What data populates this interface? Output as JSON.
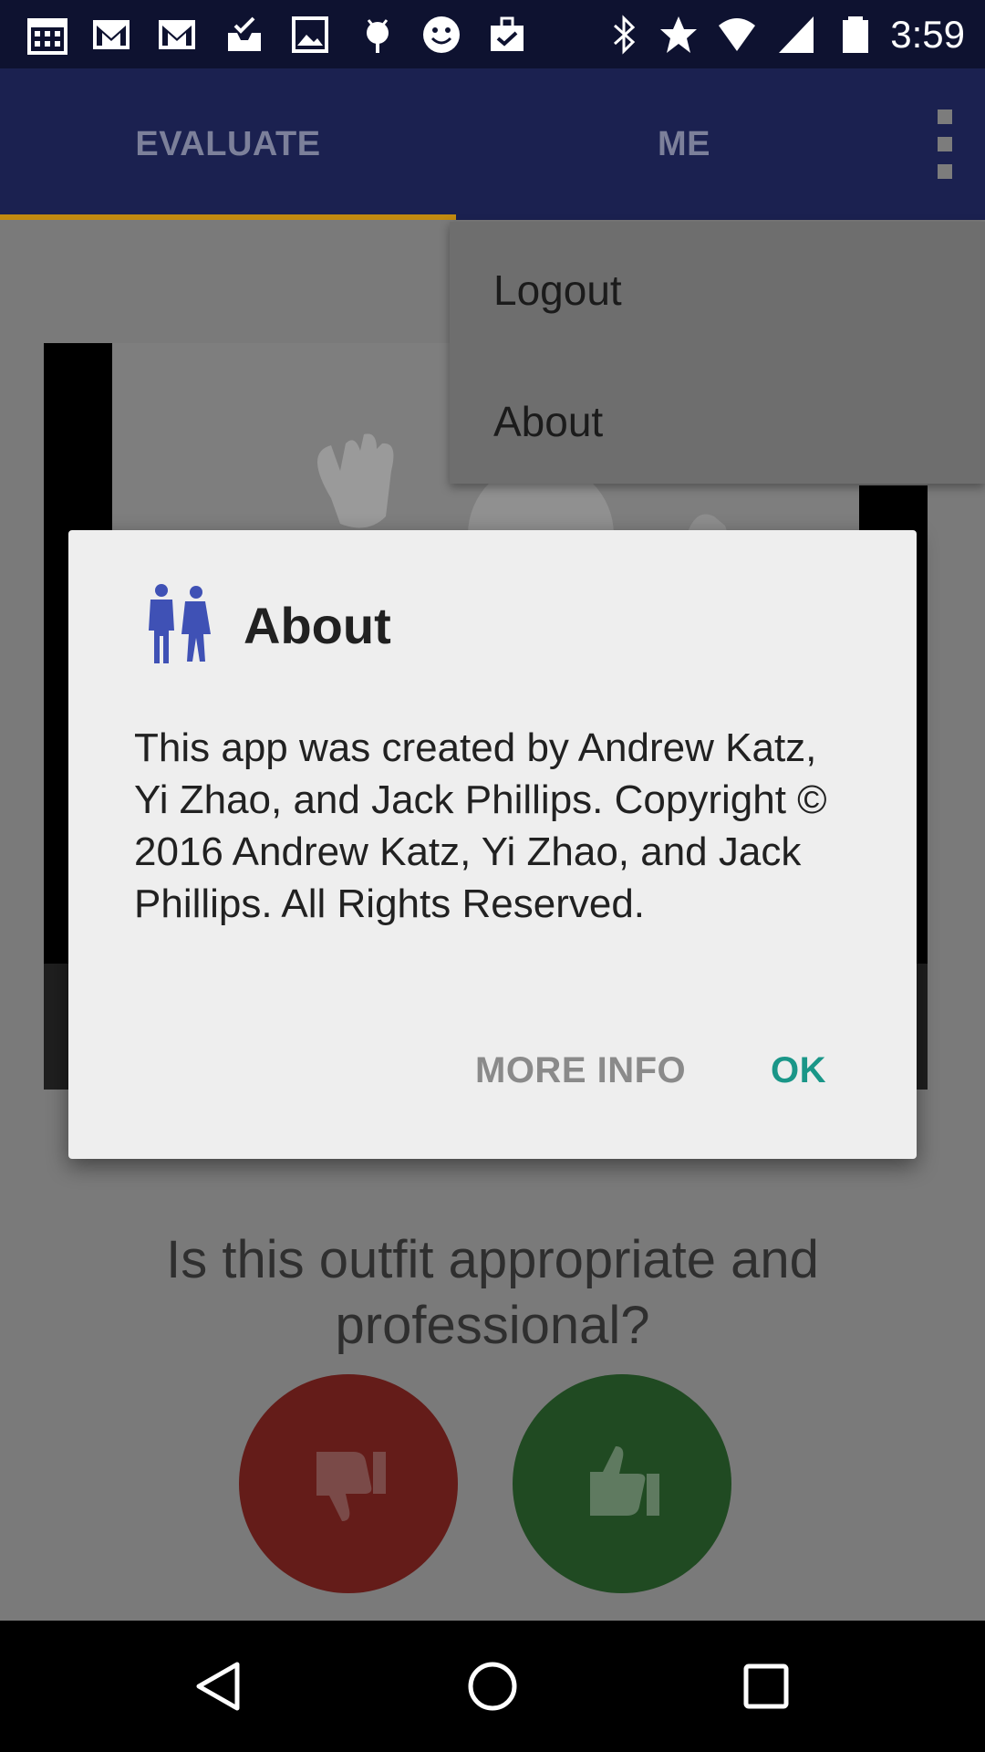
{
  "status_bar": {
    "time": "3:59",
    "icons": [
      "calendar-icon",
      "gmail-icon",
      "gmail-icon",
      "inbox-check-icon",
      "image-icon",
      "android-icon",
      "smiley-icon",
      "briefcase-check-icon",
      "bluetooth-icon",
      "star-icon",
      "wifi-icon",
      "cell-signal-icon",
      "battery-icon"
    ]
  },
  "app_bar": {
    "tabs": [
      {
        "label": "EVALUATE",
        "selected": true
      },
      {
        "label": "ME",
        "selected": false
      }
    ],
    "accent_color": "#c28a10"
  },
  "overflow_menu": {
    "items": [
      "Logout",
      "About"
    ]
  },
  "main": {
    "question": "Is this outfit appropriate and professional?",
    "buttons": {
      "no_icon": "thumbs-down-icon",
      "yes_icon": "thumbs-up-icon"
    }
  },
  "dialog": {
    "icon": "business-people-icon",
    "title": "About",
    "body": "This app was created by Andrew Katz, Yi Zhao, and Jack Phillips. Copyright © 2016 Andrew Katz, Yi Zhao, and Jack Phillips. All Rights Reserved.",
    "more_info_label": "MORE INFO",
    "ok_label": "OK",
    "ok_color": "#1a9688"
  },
  "nav_bar": {
    "icons": [
      "back-icon",
      "home-icon",
      "recents-icon"
    ]
  }
}
